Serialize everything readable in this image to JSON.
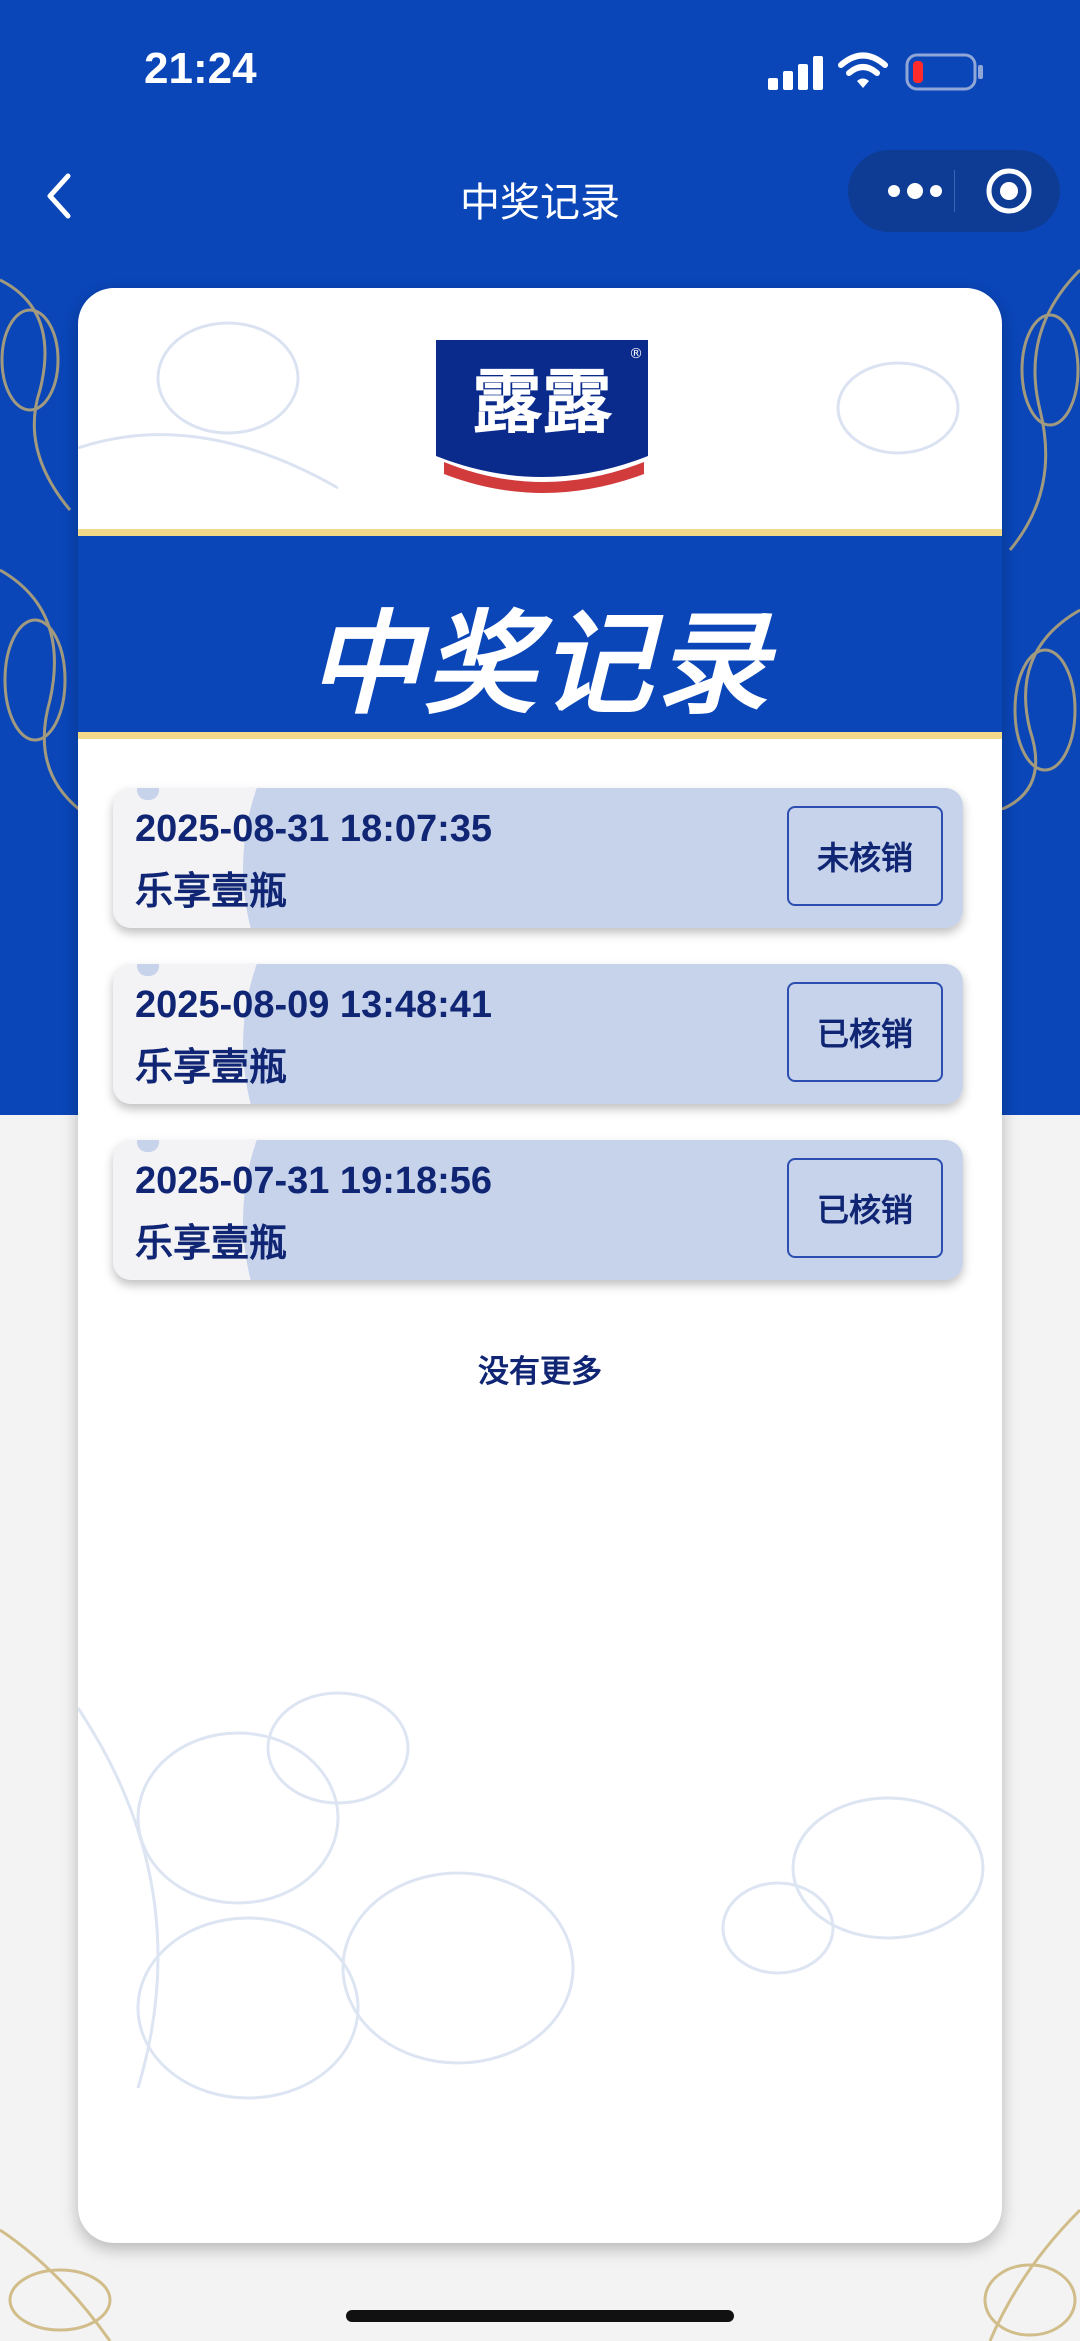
{
  "status_bar": {
    "time": "21:24"
  },
  "nav": {
    "title": "中奖记录"
  },
  "banner": {
    "title": "中奖记录"
  },
  "records": [
    {
      "datetime": "2025-08-31 18:07:35",
      "prize": "乐享壹瓶",
      "status": "未核销"
    },
    {
      "datetime": "2025-08-09 13:48:41",
      "prize": "乐享壹瓶",
      "status": "已核销"
    },
    {
      "datetime": "2025-07-31 19:18:56",
      "prize": "乐享壹瓶",
      "status": "已核销"
    }
  ],
  "footer": {
    "no_more": "没有更多"
  },
  "brand": {
    "logo_text": "露露",
    "primary_color": "#0a46b8",
    "accent_gold": "#f2d98a",
    "text_navy": "#102674"
  }
}
